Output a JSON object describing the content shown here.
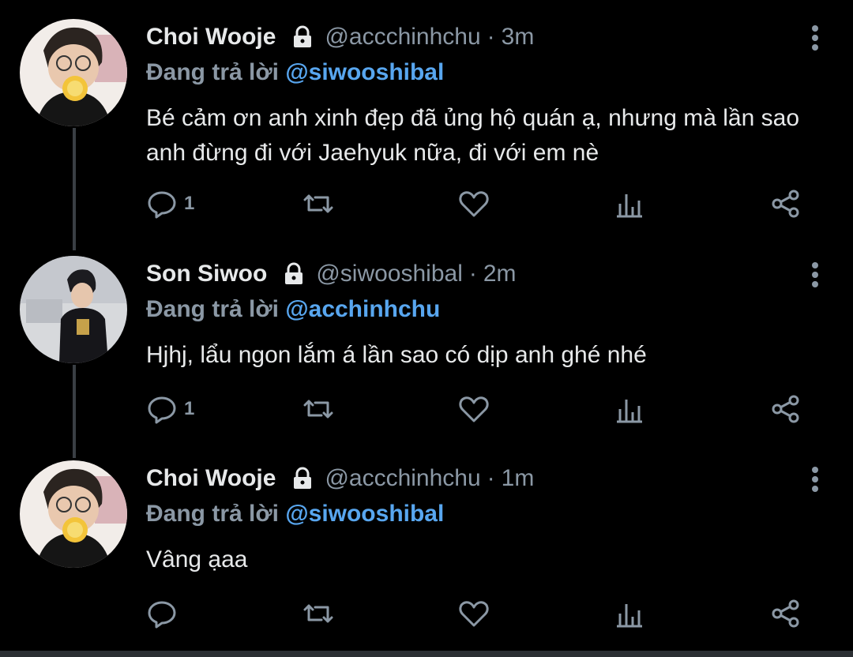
{
  "thread": {
    "tweets": [
      {
        "name": "Choi Wooje",
        "handle": "@accchinhchu",
        "separator": "·",
        "time": "3m",
        "reply_prefix": "Đang trả lời",
        "reply_to": "@siwooshibal",
        "text": "Bé cảm ơn anh xinh đẹp đã ủng hộ quán ạ, nhưng mà lần sao anh đừng đi với Jaehyuk nữa, đi với em nè",
        "reply_count": "1",
        "avatar_icon": "avatar-photo-icon"
      },
      {
        "name": "Son Siwoo",
        "handle": "@siwooshibal",
        "separator": "·",
        "time": "2m",
        "reply_prefix": "Đang trả lời",
        "reply_to": "@acchinhchu",
        "text": "Hjhj, lẩu ngon lắm á lần sao có dịp anh ghé nhé",
        "reply_count": "1",
        "avatar_icon": "avatar-photo-icon"
      },
      {
        "name": "Choi Wooje",
        "handle": "@accchinhchu",
        "separator": "·",
        "time": "1m",
        "reply_prefix": "Đang trả lời",
        "reply_to": "@siwooshibal",
        "text": "Vâng ạaa",
        "reply_count": "",
        "avatar_icon": "avatar-photo-icon"
      }
    ]
  },
  "colors": {
    "background": "#000000",
    "text": "#e7e9ea",
    "secondary": "#8b98a5",
    "mention": "#58a6ef",
    "thread_line": "#3a3f44"
  },
  "icons": [
    "lock-icon",
    "more-vertical-icon",
    "reply-icon",
    "retweet-icon",
    "like-icon",
    "views-icon",
    "share-icon"
  ]
}
